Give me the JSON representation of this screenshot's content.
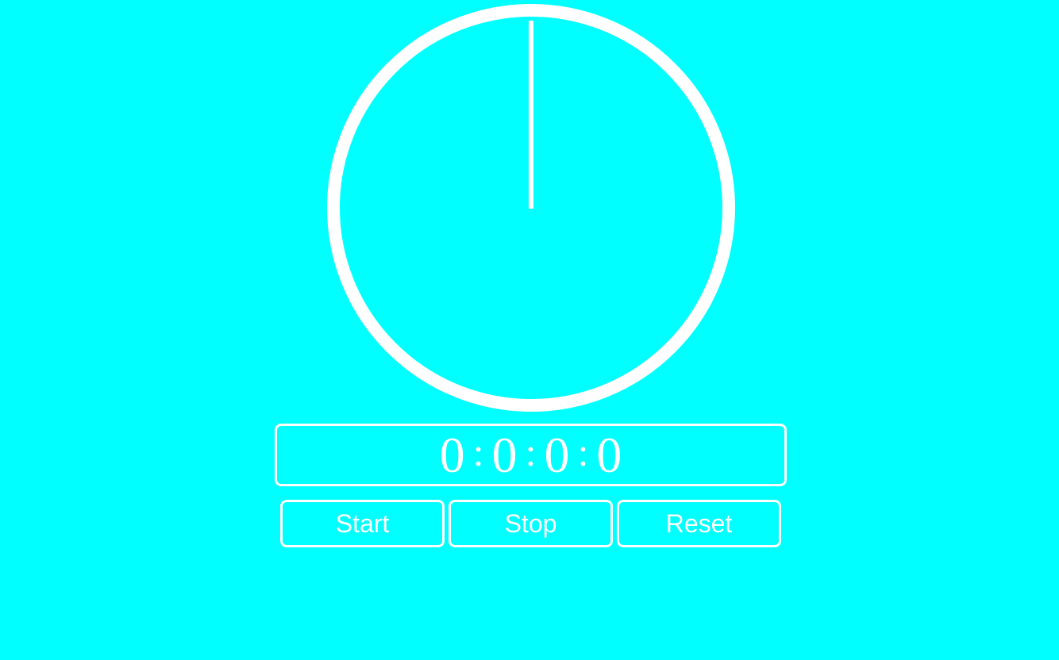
{
  "stopwatch": {
    "hours": "0",
    "minutes": "0",
    "seconds": "0",
    "centiseconds": "0",
    "separator": ":",
    "hand_angle_deg": 0
  },
  "controls": {
    "start_label": "Start",
    "stop_label": "Stop",
    "reset_label": "Reset"
  },
  "colors": {
    "background": "#00ffff",
    "foreground": "#ffffff"
  }
}
